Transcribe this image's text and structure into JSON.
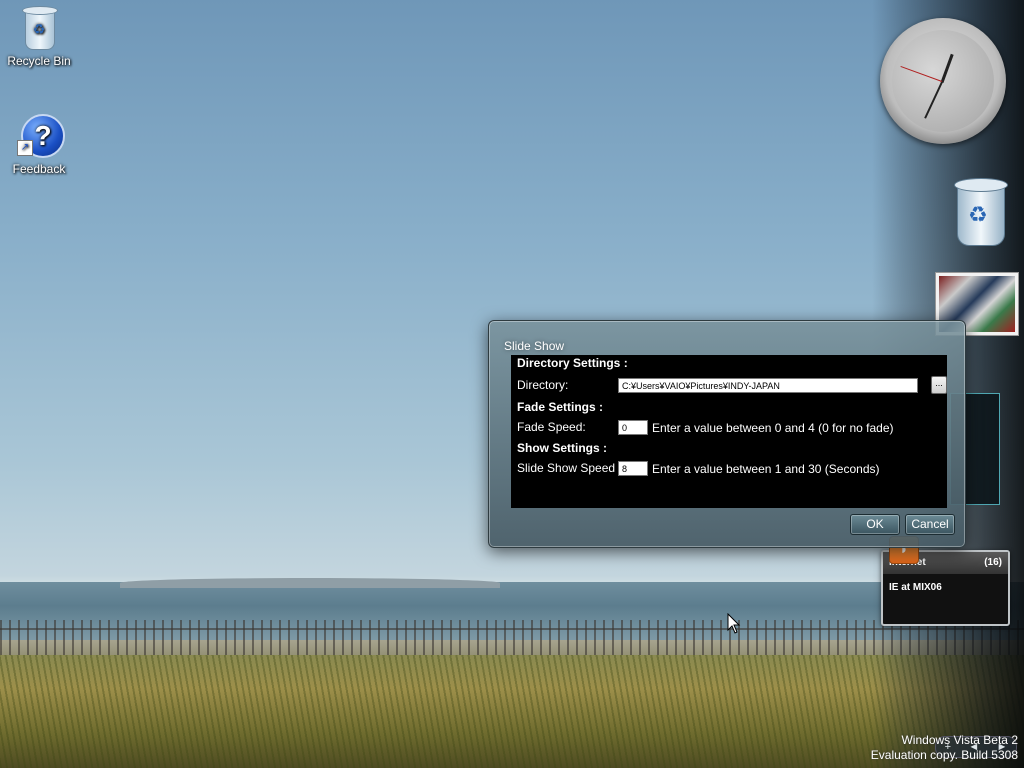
{
  "desktop": {
    "icons": [
      {
        "label": "Recycle Bin",
        "icon": "recycle-bin-icon"
      },
      {
        "label": "Feedback",
        "icon": "help-icon"
      }
    ]
  },
  "sidebar": {
    "feed": {
      "title": "Internet",
      "count": "(16)",
      "item": "IE at MIX06"
    },
    "controls": [
      "+",
      "◄",
      "►"
    ]
  },
  "watermark": {
    "line1": "Windows Vista Beta 2",
    "line2": "Evaluation copy. Build 5308"
  },
  "dialog": {
    "title": "Slide Show",
    "directory_section": "Directory Settings :",
    "directory_label": "Directory:",
    "directory_value": "C:¥Users¥VAIO¥Pictures¥INDY-JAPAN",
    "browse_label": "...",
    "fade_section": "Fade Settings :",
    "fade_label": "Fade Speed:",
    "fade_value": "0",
    "fade_hint": "Enter a value between 0 and 4 (0 for no fade)",
    "show_section": "Show Settings :",
    "show_label": "Slide Show Speed :",
    "show_value": "8",
    "show_hint": "Enter a value between 1 and 30 (Seconds)",
    "ok_label": "OK",
    "cancel_label": "Cancel"
  }
}
